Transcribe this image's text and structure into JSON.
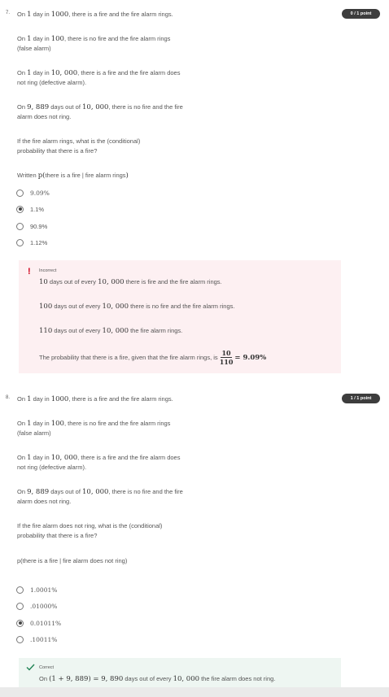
{
  "q7": {
    "number": "7.",
    "badge": "0 / 1 point",
    "intro_pre": "On ",
    "intro_m1": "1",
    "intro_mid": " day in ",
    "intro_m2": "1000",
    "intro_post": ", there is a fire and the fire alarm rings.",
    "p1_pre": "On ",
    "p1_m1": "1",
    "p1_mid": " day in ",
    "p1_m2": "100",
    "p1_post": ", there is no fire and the fire alarm rings",
    "p1_line2": "(false alarm)",
    "p2_pre": "On ",
    "p2_m1": "1",
    "p2_mid": " day in ",
    "p2_m2": "10, 000",
    "p2_post": ", there is a fire and the fire alarm does",
    "p2_line2": "not ring (defective alarm).",
    "p3_pre": "On ",
    "p3_m1": "9, 889",
    "p3_mid": " days out of ",
    "p3_m2": "10, 000",
    "p3_post": ", there is no fire and the fire",
    "p3_line2": "alarm does not ring.",
    "question_l1": "If the fire alarm rings, what is the (conditional)",
    "question_l2": "probability that there is a fire?",
    "written_pre": "Written ",
    "written_math": "p(",
    "written_text": "there is a fire | fire alarm rings",
    "written_close": ")",
    "options": [
      {
        "label": "9.09%",
        "checked": false,
        "math": true
      },
      {
        "label": "1.1%",
        "checked": true,
        "math": false
      },
      {
        "label": "90.9%",
        "checked": false,
        "math": false
      },
      {
        "label": "1.12%",
        "checked": false,
        "math": false
      }
    ],
    "feedback": {
      "status": "Incorrect",
      "l1_pre": "10",
      "l1_mid": " days out of every ",
      "l1_m": "10, 000",
      "l1_post": " there is fire and the fire alarm rings.",
      "l2_pre": "100",
      "l2_mid": " days out of every ",
      "l2_m": "10, 000",
      "l2_post": " there is no fire and the fire alarm rings.",
      "l3_pre": "110",
      "l3_mid": " days out of every ",
      "l3_m": "10, 000",
      "l3_post": " the fire alarm rings.",
      "l4_text": "The probability that there is a fire, given that the fire alarm rings, is",
      "l4_num": "10",
      "l4_den": "110",
      "l4_result": "= 9.09%"
    }
  },
  "q8": {
    "number": "8.",
    "badge": "1 / 1 point",
    "intro_pre": "On ",
    "intro_m1": "1",
    "intro_mid": " day in ",
    "intro_m2": "1000",
    "intro_post": ", there is a fire and the fire alarm rings.",
    "p1_pre": "On ",
    "p1_m1": "1",
    "p1_mid": " day in ",
    "p1_m2": "100",
    "p1_post": ", there is no fire and the fire alarm rings",
    "p1_line2": "(false alarm)",
    "p2_pre": "On ",
    "p2_m1": "1",
    "p2_mid": " day in ",
    "p2_m2": "10, 000",
    "p2_post": ", there is a fire and the fire alarm does",
    "p2_line2": "not ring (defective alarm).",
    "p3_pre": "On ",
    "p3_m1": "9, 889",
    "p3_mid": " days out of ",
    "p3_m2": "10, 000",
    "p3_post": ", there is no fire and the fire",
    "p3_line2": "alarm does not ring.",
    "question_l1": "If the fire alarm does not ring, what is the (conditional)",
    "question_l2": "probability that there is a fire?",
    "written": "p(there is a fire | fire alarm does not ring)",
    "options": [
      {
        "label": "1.0001%",
        "checked": false
      },
      {
        "label": ".01000%",
        "checked": false
      },
      {
        "label": "0.01011%",
        "checked": true
      },
      {
        "label": ".10011%",
        "checked": false
      }
    ],
    "feedback": {
      "status": "Correct",
      "l1_pre": "On ",
      "l1_m": "(1 + 9, 889) = 9, 890",
      "l1_mid": " days out of every ",
      "l1_m2": "10, 000",
      "l1_post": " the fire alarm does not ring."
    }
  },
  "colors": {
    "badge_bg": "#3d3d3d",
    "incorrect_bg": "#fdf0f2",
    "incorrect_icon": "#d0021b",
    "correct_bg": "#eef6f2",
    "correct_icon": "#1f8354"
  },
  "icons": {
    "incorrect": "exclamation-icon",
    "correct": "checkmark-icon"
  }
}
